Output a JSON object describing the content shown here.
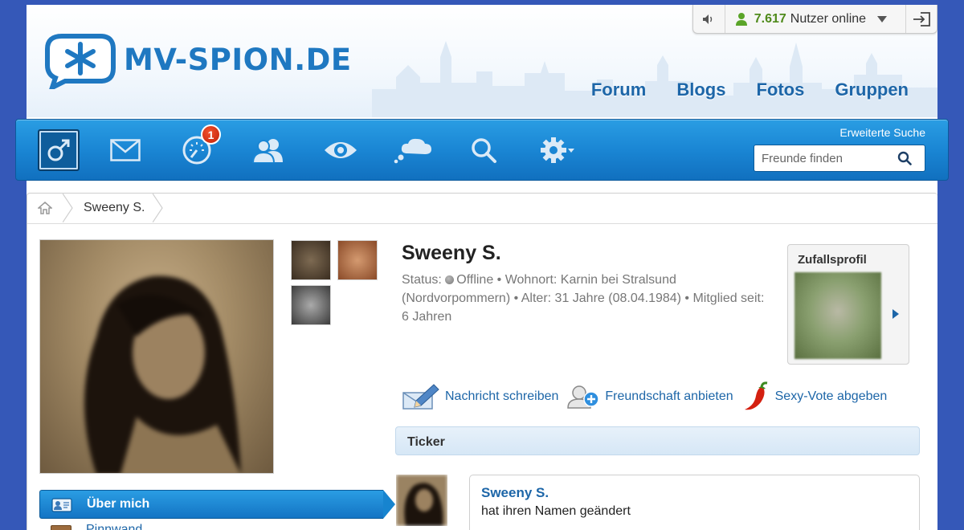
{
  "brand": {
    "logo_text": "MV-SPION.DE",
    "accent": "#1f78c1",
    "toolbar": "#1a86d4"
  },
  "header_nav": [
    "Forum",
    "Blogs",
    "Fotos",
    "Gruppen"
  ],
  "online": {
    "count": "7.617",
    "label": "Nutzer online"
  },
  "toolbar": {
    "items": [
      {
        "name": "profile-gender-icon",
        "active": true
      },
      {
        "name": "messages-icon"
      },
      {
        "name": "activity-meter-icon",
        "badge": "1"
      },
      {
        "name": "friends-icon"
      },
      {
        "name": "visitors-eye-icon"
      },
      {
        "name": "chat-cloud-icon"
      },
      {
        "name": "search-icon"
      },
      {
        "name": "settings-gear-icon"
      }
    ],
    "advanced_search": "Erweiterte Suche",
    "search_placeholder": "Freunde finden"
  },
  "breadcrumb": {
    "current": "Sweeny S."
  },
  "profile": {
    "name": "Sweeny S.",
    "status_label": "Status:",
    "status": "Offline",
    "meta_rest": " • Wohnort: Karnin bei Stralsund (Nordvorpommern) • Alter: 31 Jahre (08.04.1984) • Mitglied seit: 6 Jahren"
  },
  "random_profile": {
    "title": "Zufallsprofil"
  },
  "actions": [
    "Nachricht schreiben",
    "Freundschaft anbieten",
    "Sexy-Vote abgeben"
  ],
  "ticker": {
    "title": "Ticker",
    "entry_user": "Sweeny S.",
    "entry_text": "hat ihren Namen geändert"
  },
  "sidenav": {
    "active": "Über mich",
    "next": "Pinnwand"
  }
}
